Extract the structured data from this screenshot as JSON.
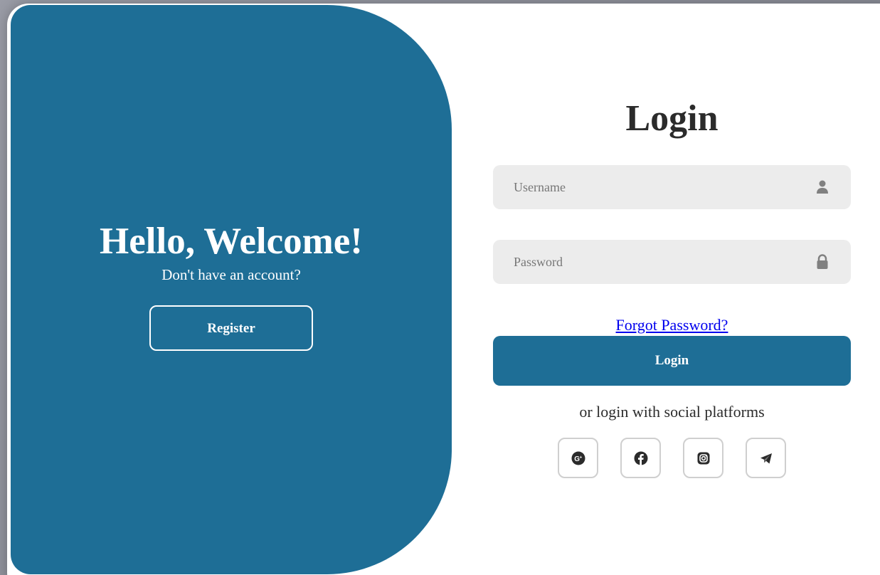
{
  "welcome": {
    "title": "Hello, Welcome!",
    "subtitle": "Don't have an account?",
    "register_label": "Register"
  },
  "login": {
    "title": "Login",
    "username_placeholder": "Username",
    "password_placeholder": "Password",
    "forgot_label": "Forgot Password?",
    "login_label": "Login",
    "social_text": "or login with social platforms"
  },
  "social": [
    {
      "icon": "google-plus-icon"
    },
    {
      "icon": "facebook-icon"
    },
    {
      "icon": "instagram-icon"
    },
    {
      "icon": "telegram-icon"
    }
  ],
  "colors": {
    "primary": "#1e6e96",
    "field_bg": "#ececec",
    "link": "#0000ee"
  }
}
